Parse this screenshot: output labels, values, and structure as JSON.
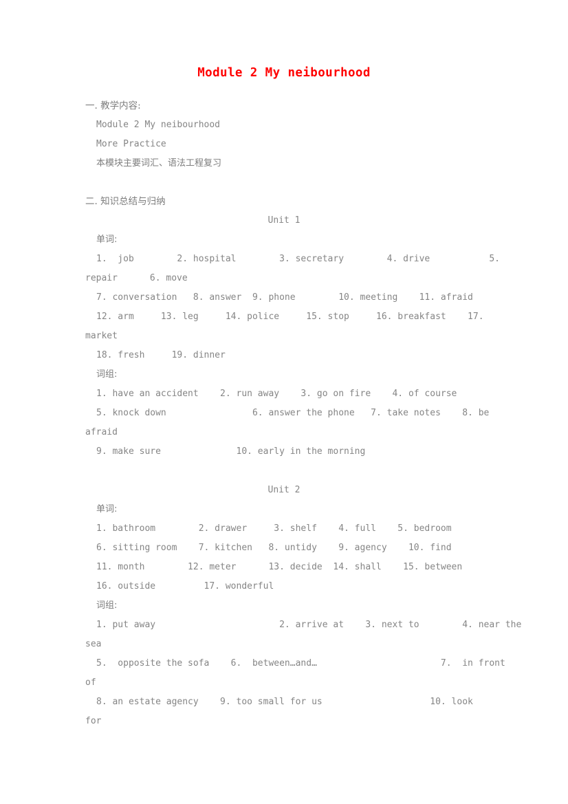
{
  "document": {
    "title": "Module 2 My neibourhood",
    "title_color": "#ff0000",
    "body_color": "#858585"
  },
  "sections": {
    "one": {
      "heading": "一. 教学内容:",
      "lines": [
        "Module 2 My neibourhood",
        "More Practice",
        "本模块主要词汇、语法工程复习"
      ]
    },
    "two": {
      "heading": "二. 知识总结与归纳"
    }
  },
  "unit1": {
    "heading": "Unit 1",
    "words_label": "单词:",
    "words_lines": [
      "1.  job        2. hospital        3. secretary        4. drive           5.",
      "repair      6. move",
      "7. conversation   8. answer  9. phone        10. meeting    11. afraid",
      "12. arm     13. leg     14. police     15. stop     16. breakfast    17.",
      "market",
      "18. fresh     19. dinner"
    ],
    "phrases_label": "词组:",
    "phrases_lines": [
      "1. have an accident    2. run away    3. go on fire    4. of course",
      "5. knock down                6. answer the phone   7. take notes    8. be",
      "afraid",
      "9. make sure              10. early in the morning"
    ]
  },
  "unit2": {
    "heading": "Unit 2",
    "words_label": "单词:",
    "words_lines": [
      "1. bathroom        2. drawer     3. shelf    4. full    5. bedroom",
      "6. sitting room    7. kitchen   8. untidy    9. agency    10. find",
      "11. month        12. meter      13. decide  14. shall    15. between",
      "16. outside         17. wonderful"
    ],
    "phrases_label": "词组:",
    "phrases_lines": [
      "1. put away                       2. arrive at    3. next to        4. near the",
      "sea",
      "5.  opposite the sofa    6.  between…and…                       7.  in front",
      "of",
      "8. an estate agency    9. too small for us                    10. look",
      "for"
    ]
  }
}
